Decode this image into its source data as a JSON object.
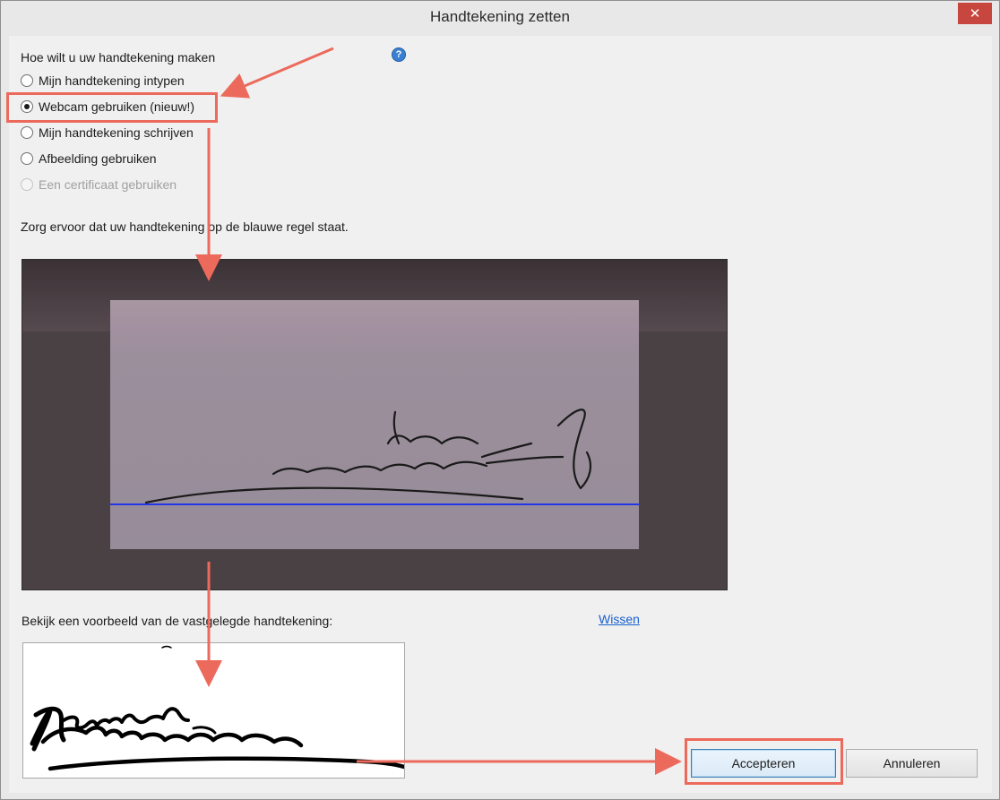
{
  "window": {
    "title": "Handtekening zetten",
    "close_glyph": "✕"
  },
  "method": {
    "heading": "Hoe wilt u uw handtekening maken",
    "help_glyph": "?",
    "options": [
      {
        "label": "Mijn handtekening intypen",
        "checked": false,
        "disabled": false
      },
      {
        "label": "Webcam gebruiken (nieuw!)",
        "checked": true,
        "disabled": false
      },
      {
        "label": "Mijn handtekening schrijven",
        "checked": false,
        "disabled": false
      },
      {
        "label": "Afbeelding gebruiken",
        "checked": false,
        "disabled": false
      },
      {
        "label": "Een certificaat gebruiken",
        "checked": false,
        "disabled": true
      }
    ]
  },
  "webcam": {
    "instruction": "Zorg ervoor dat uw handtekening op de blauwe regel staat.",
    "guide_line_color": "#2136e8"
  },
  "preview": {
    "label": "Bekijk een voorbeeld van de vastgelegde handtekening:",
    "clear_link": "Wissen"
  },
  "buttons": {
    "accept": "Accepteren",
    "cancel": "Annuleren"
  },
  "annotations": {
    "color": "#ec6a5c"
  }
}
